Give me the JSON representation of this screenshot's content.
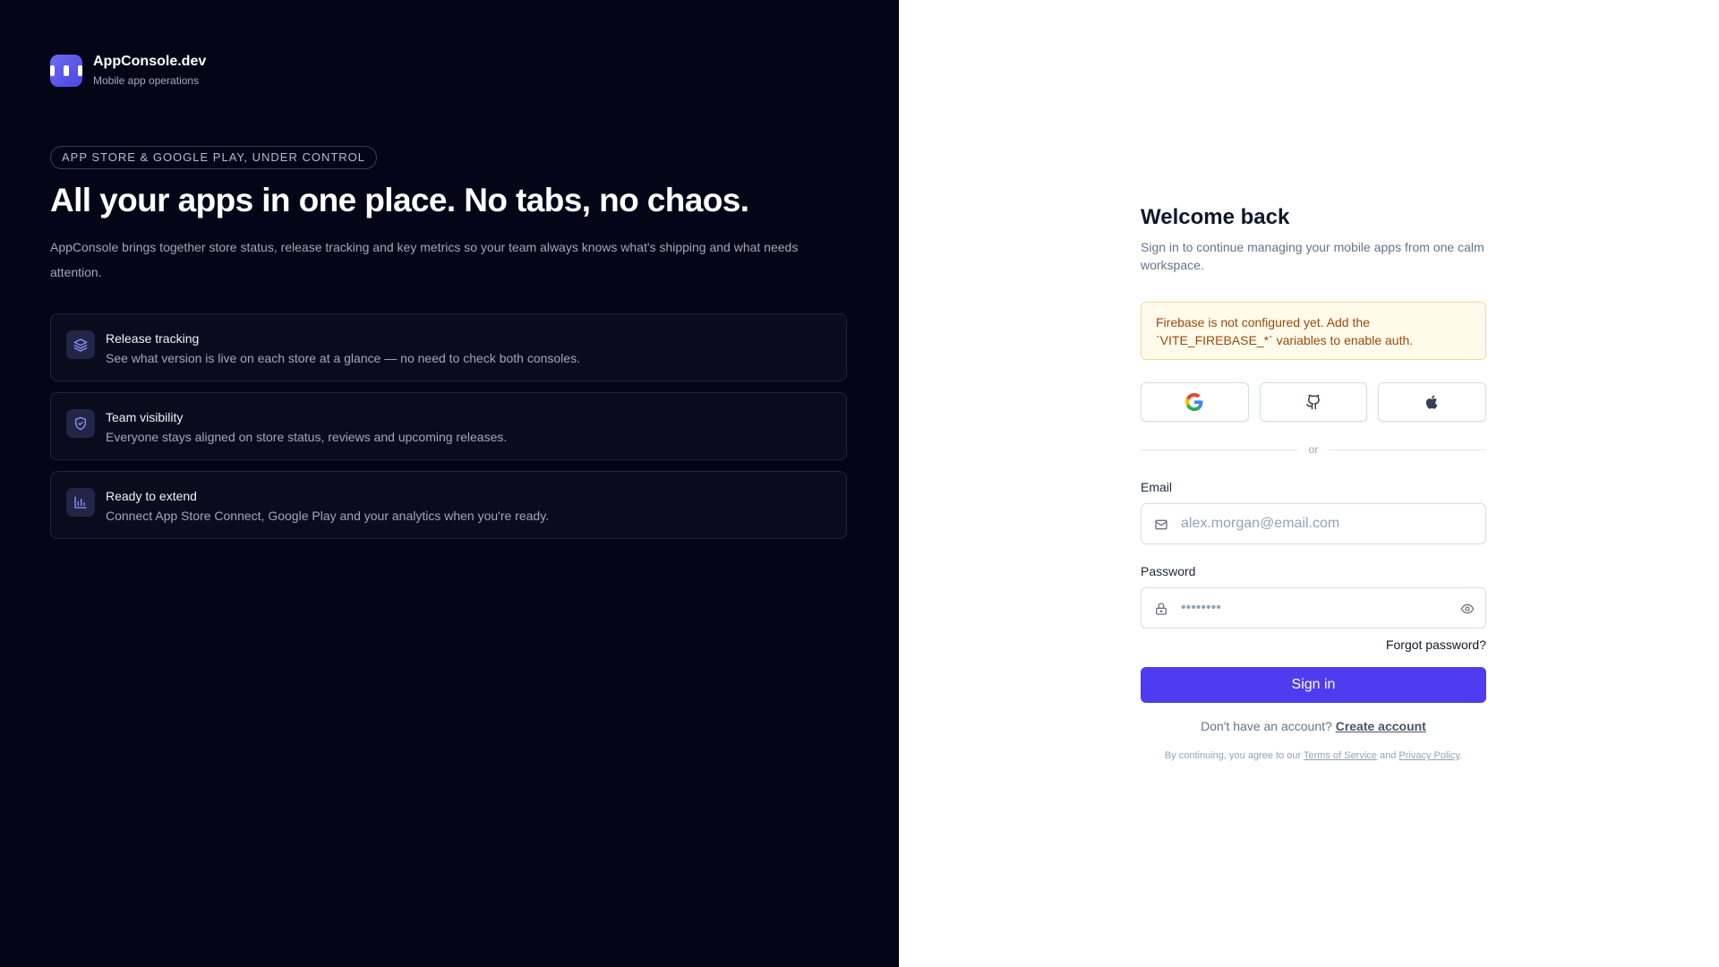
{
  "brand": {
    "name": "AppConsole.dev",
    "tagline": "Mobile app operations"
  },
  "hero": {
    "pill": "APP STORE & GOOGLE PLAY, UNDER CONTROL",
    "headline": "All your apps in one place. No tabs, no chaos.",
    "lead": "AppConsole brings together store status, release tracking and key metrics so your team always knows what's shipping and what needs attention."
  },
  "features": [
    {
      "icon": "layers-icon",
      "title": "Release tracking",
      "desc": "See what version is live on each store at a glance — no need to check both consoles."
    },
    {
      "icon": "shield-check-icon",
      "title": "Team visibility",
      "desc": "Everyone stays aligned on store status, reviews and upcoming releases."
    },
    {
      "icon": "bar-chart-icon",
      "title": "Ready to extend",
      "desc": "Connect App Store Connect, Google Play and your analytics when you're ready."
    }
  ],
  "login": {
    "title": "Welcome back",
    "subtitle": "Sign in to continue managing your mobile apps from one calm workspace.",
    "alert": "Firebase is not configured yet. Add the `VITE_FIREBASE_*` variables to enable auth.",
    "social": [
      "google-icon",
      "github-icon",
      "apple-icon"
    ],
    "divider": "or",
    "email_label": "Email",
    "email_placeholder": "alex.morgan@email.com",
    "password_label": "Password",
    "password_placeholder": "••••••••",
    "forgot": "Forgot password?",
    "submit": "Sign in",
    "no_account": "Don't have an account?",
    "create_account": "Create account",
    "terms_prefix": "By continuing, you agree to our",
    "terms_link": "Terms of Service",
    "terms_and": "and",
    "privacy_link": "Privacy Policy",
    "terms_suffix": "."
  },
  "colors": {
    "left_bg": "#040617",
    "primary": "#4f3cf0",
    "alert_bg": "#fffbeb",
    "alert_text": "#9a4a0c"
  }
}
